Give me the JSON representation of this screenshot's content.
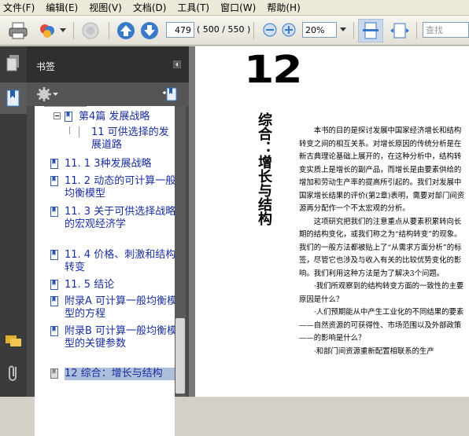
{
  "menu": [
    "文件(F)",
    "编辑(E)",
    "视图(V)",
    "文档(D)",
    "工具(T)",
    "窗口(W)",
    "帮助(H)"
  ],
  "toolbar": {
    "current_page": "479",
    "page_total": "( 500 / 550 )",
    "zoom": "20%",
    "search_placeholder": "查找"
  },
  "panel": {
    "title": "书签"
  },
  "bookmarks": [
    {
      "label": "第4篇 发展战略"
    },
    {
      "label": "11 可供选择的发展道路"
    },
    {
      "label": "11. 1 3种发展战略"
    },
    {
      "label": "11. 2 动态的可计算一般均衡模型"
    },
    {
      "label": "11. 3 关于可供选择战略的宏观经济学"
    },
    {
      "label": "11. 4 价格、刺激和结构转变"
    },
    {
      "label": "11. 5 结论"
    },
    {
      "label": "附录A 可计算一般均衡模型的方程"
    },
    {
      "label": "附录B 可计算一般均衡模型的关键参数"
    },
    {
      "label": "12 综合：增长与结构"
    }
  ],
  "document": {
    "chapter_number": "12",
    "chapter_title": "综合：增长与结构",
    "paragraphs": [
      "本书的目的是探讨发展中国家经济增长和结构转变之间的相互关系。对增长原因的传统分析是在新古典理论基础上展开的，在这种分析中，结构转变实质上是增长的副产品，而增长是由要素供给的增加和劳动生产率的提高所引起的。我们对发展中国家增长结果的评价(第2章)表明，需要对部门间资源再分配作一个不太宏观的分析。",
      "这项研究把我们的注意重点从要素积累转向长期的结构变化，或我们称之为“结构转变”的现象。我们的一般方法都被贴上了“从需求方面分析”的标签，尽管它也涉及与收入有关的比较优势变化的影响。我们利用这种方法是为了解决3个问题。",
      "·我们所观察到的结构转变方面的一致性的主要原因是什么？",
      "·人们预期能从中产生工业化的不同结果的要素——自然资源的可获得性、市场范围以及外部政策——的影响是什么？",
      "·和部门间资源重新配置相联系的生产"
    ]
  }
}
